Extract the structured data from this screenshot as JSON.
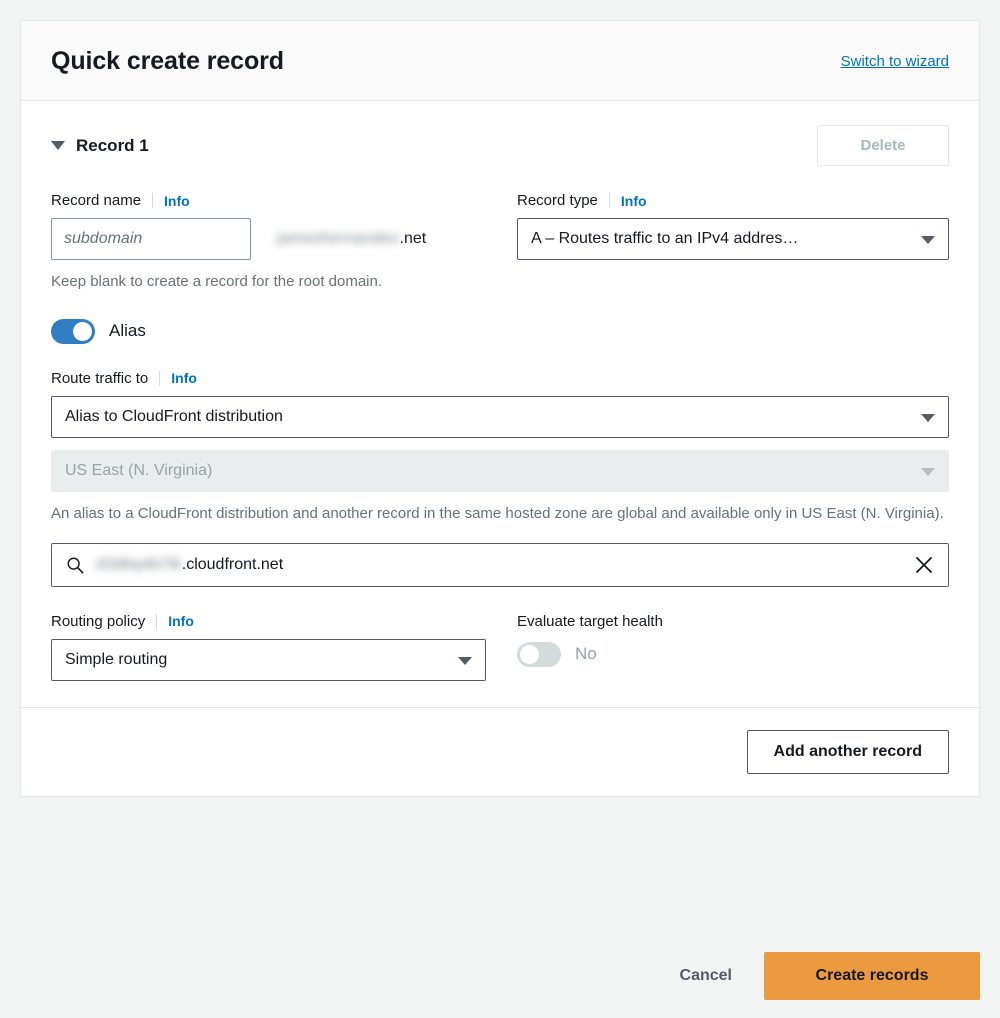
{
  "header": {
    "title": "Quick create record",
    "switch_link": "Switch to wizard"
  },
  "record": {
    "label": "Record 1",
    "delete_label": "Delete",
    "delete_disabled": true,
    "record_name": {
      "label": "Record name",
      "info": "Info",
      "value": "",
      "placeholder": "subdomain",
      "domain_redacted": "jameshernandez",
      "domain_suffix": ".net",
      "helper": "Keep blank to create a record for the root domain."
    },
    "record_type": {
      "label": "Record type",
      "info": "Info",
      "value": "A – Routes traffic to an IPv4 addres…"
    },
    "alias": {
      "label": "Alias",
      "state": "on"
    },
    "route_traffic": {
      "label": "Route traffic to",
      "info": "Info",
      "target_value": "Alias to CloudFront distribution",
      "region_value": "US East (N. Virginia)",
      "region_disabled": true,
      "helper": "An alias to a CloudFront distribution and another record in the same hosted zone are global and available only in US East (N. Virginia).",
      "endpoint_redacted": "d3dbq4b7lk",
      "endpoint_suffix": ".cloudfront.net",
      "search_icon": "search-icon",
      "clear_icon": "close-icon"
    },
    "routing_policy": {
      "label": "Routing policy",
      "info": "Info",
      "value": "Simple routing"
    },
    "evaluate_target_health": {
      "label": "Evaluate target health",
      "state": "off",
      "state_label": "No"
    }
  },
  "footer": {
    "add_another_label": "Add another record"
  },
  "actions": {
    "cancel_label": "Cancel",
    "create_label": "Create records"
  },
  "colors": {
    "page_background": "#f2f3f3",
    "accent_link": "#0073bb",
    "primary_button": "#ec9a40",
    "toggle_on": "#2f7ec4",
    "toggle_off": "#d5dbdb",
    "text": "#16191f",
    "muted_text": "#687078"
  }
}
